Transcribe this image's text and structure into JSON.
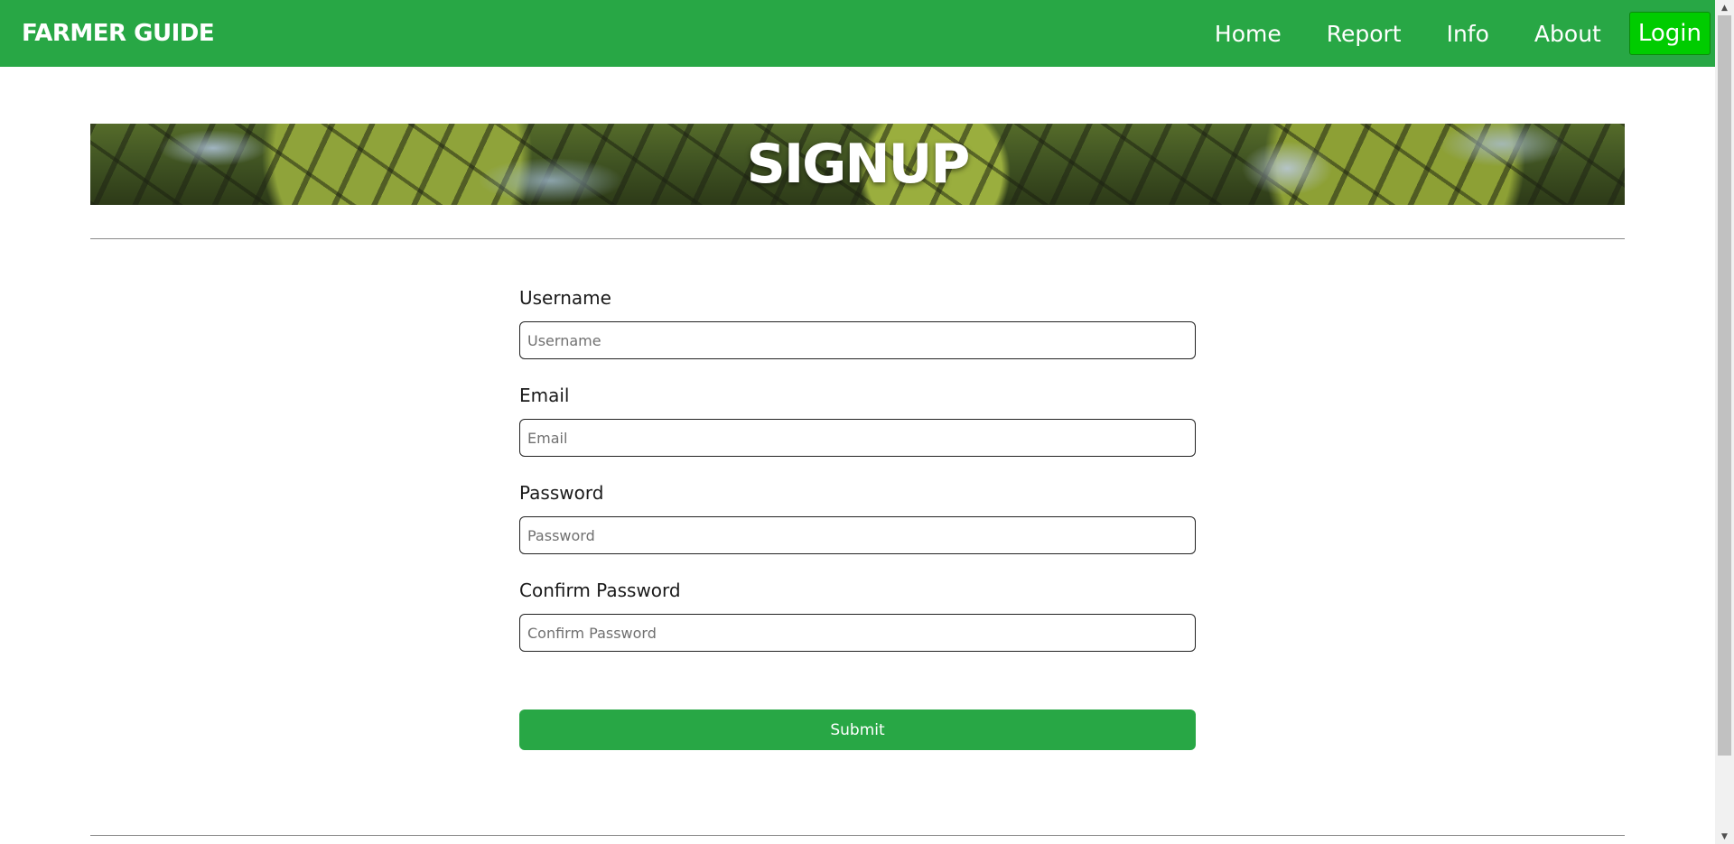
{
  "colors": {
    "brand_green": "#28a745",
    "login_green": "#00cc00",
    "rule_gray": "#8a8a8a"
  },
  "navbar": {
    "brand": "FARMER GUIDE",
    "links": [
      "Home",
      "Report",
      "Info",
      "About"
    ],
    "login_label": "Login"
  },
  "banner": {
    "title": "SIGNUP"
  },
  "form": {
    "fields": [
      {
        "label": "Username",
        "placeholder": "Username",
        "value": ""
      },
      {
        "label": "Email",
        "placeholder": "Email",
        "value": ""
      },
      {
        "label": "Password",
        "placeholder": "Password",
        "value": ""
      },
      {
        "label": "Confirm Password",
        "placeholder": "Confirm Password",
        "value": ""
      }
    ],
    "submit_label": "Submit"
  },
  "scrollbar": {
    "up_icon": "triangle-up-icon",
    "down_icon": "triangle-down-icon"
  }
}
